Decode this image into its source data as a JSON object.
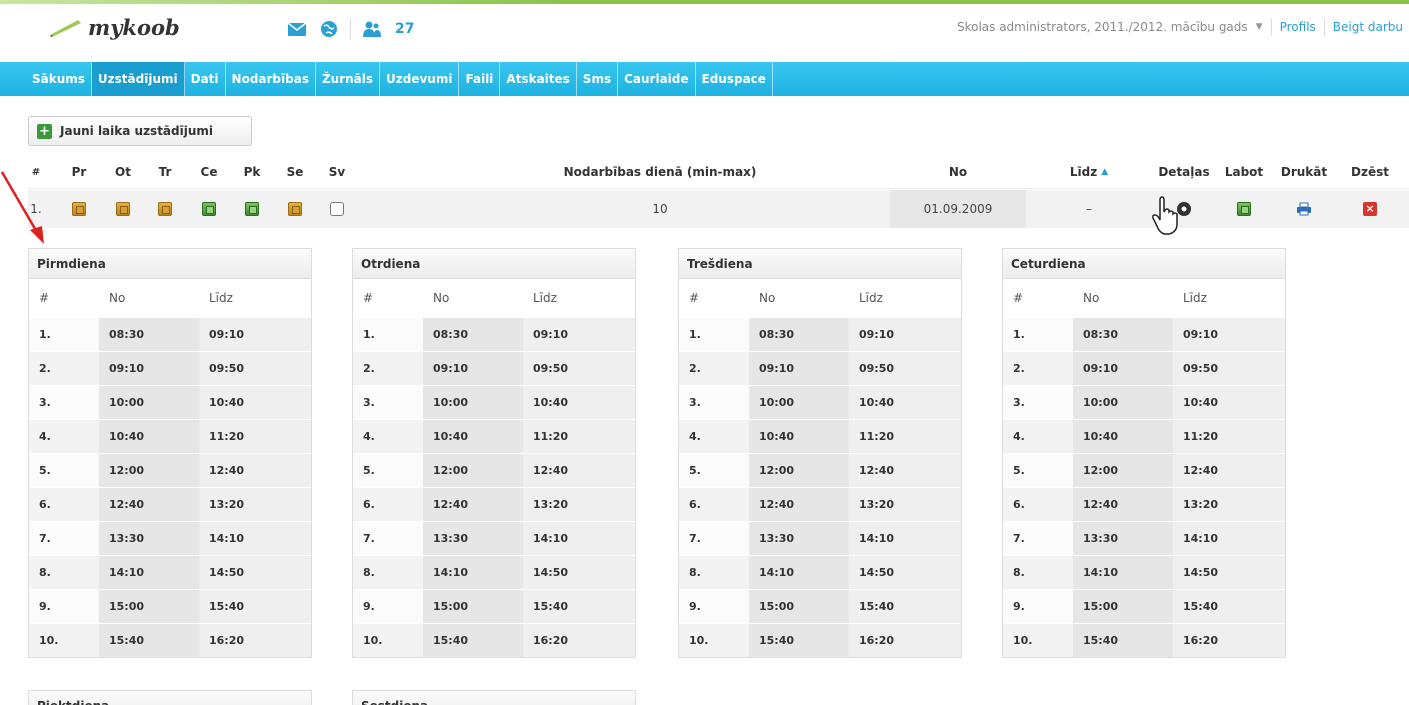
{
  "header": {
    "brand": "mykoob",
    "users_count": "27",
    "role_text": "Skolas administrators, 2011./2012. mācību gads",
    "profile_link": "Profils",
    "logout_link": "Beigt darbu"
  },
  "nav": {
    "items": [
      "Sākums",
      "Uzstādījumi",
      "Dati",
      "Nodarbības",
      "Žurnāls",
      "Uzdevumi",
      "Faili",
      "Atskaites",
      "Sms",
      "Caurlaide",
      "Eduspace"
    ],
    "active_index": 1
  },
  "toolbar": {
    "new_button": "Jauni laika uzstādījumi"
  },
  "schedule_table": {
    "headers": {
      "num": "#",
      "pr": "Pr",
      "ot": "Ot",
      "tr": "Tr",
      "ce": "Ce",
      "pk": "Pk",
      "se": "Se",
      "sv": "Sv",
      "per_day": "Nodarbības dienā (min-max)",
      "from": "No",
      "to": "Līdz",
      "details": "Detaļas",
      "edit": "Labot",
      "print": "Drukāt",
      "delete": "Dzēst"
    },
    "row": {
      "num": "1.",
      "per_day": "10",
      "from": "01.09.2009",
      "to": "–"
    }
  },
  "day_panels": [
    {
      "title": "Pirmdiena"
    },
    {
      "title": "Otrdiena"
    },
    {
      "title": "Trešdiena"
    },
    {
      "title": "Ceturdiena"
    },
    {
      "title": "Piektdiena"
    },
    {
      "title": "Sestdiena"
    }
  ],
  "period_headers": {
    "num": "#",
    "from": "No",
    "to": "Līdz"
  },
  "periods": [
    {
      "n": "1.",
      "from": "08:30",
      "to": "09:10"
    },
    {
      "n": "2.",
      "from": "09:10",
      "to": "09:50"
    },
    {
      "n": "3.",
      "from": "10:00",
      "to": "10:40"
    },
    {
      "n": "4.",
      "from": "10:40",
      "to": "11:20"
    },
    {
      "n": "5.",
      "from": "12:00",
      "to": "12:40"
    },
    {
      "n": "6.",
      "from": "12:40",
      "to": "13:20"
    },
    {
      "n": "7.",
      "from": "13:30",
      "to": "14:10"
    },
    {
      "n": "8.",
      "from": "14:10",
      "to": "14:50"
    },
    {
      "n": "9.",
      "from": "15:00",
      "to": "15:40"
    },
    {
      "n": "10.",
      "from": "15:40",
      "to": "16:20"
    }
  ],
  "colors": {
    "nav": "#1eb2e2",
    "link": "#2a9fd6",
    "accent_green": "#8bc34a",
    "annotation_arrow": "#e02020"
  }
}
